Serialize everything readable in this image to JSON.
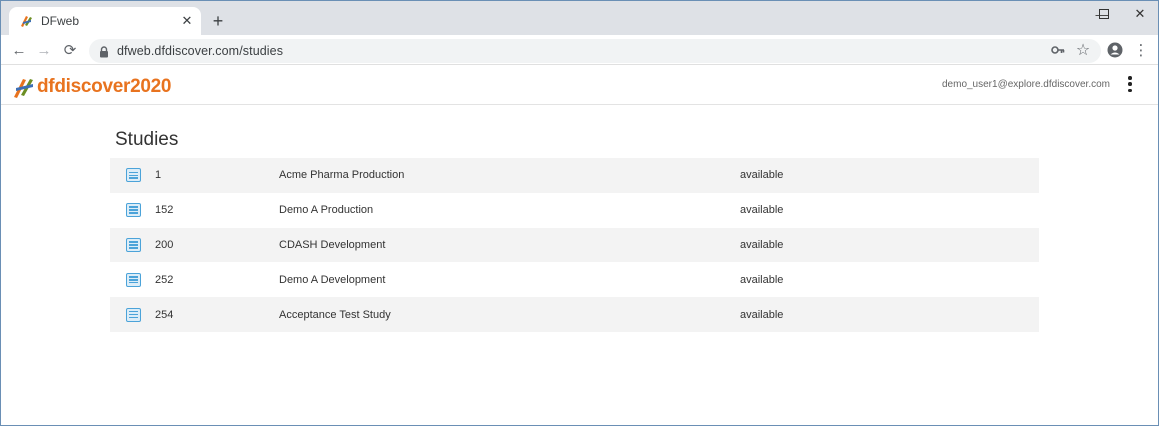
{
  "browser": {
    "tab_title": "DFweb",
    "tab_close": "✕",
    "new_tab": "+",
    "url": "dfweb.dfdiscover.com/studies",
    "window_controls": {
      "minimize": "—",
      "maximize": "☐",
      "close": "✕"
    },
    "nav": {
      "back": "←",
      "forward": "→",
      "reload": "⟳"
    },
    "omnibox_icons": {
      "key": "⚿",
      "star": "☆",
      "menu": "⋮"
    }
  },
  "app": {
    "logo_text": "dfdiscover2020",
    "user_email": "demo_user1@explore.dfdiscover.com"
  },
  "page": {
    "title": "Studies"
  },
  "studies": [
    {
      "id": "1",
      "name": "Acme Pharma Production",
      "status": "available"
    },
    {
      "id": "152",
      "name": "Demo A Production",
      "status": "available"
    },
    {
      "id": "200",
      "name": "CDASH Development",
      "status": "available"
    },
    {
      "id": "252",
      "name": "Demo A Development",
      "status": "available"
    },
    {
      "id": "254",
      "name": "Acceptance Test Study",
      "status": "available"
    }
  ],
  "colors": {
    "brand_orange": "#e8731f",
    "icon_blue": "#4ba3d9",
    "row_stripe": "#f3f3f3"
  }
}
